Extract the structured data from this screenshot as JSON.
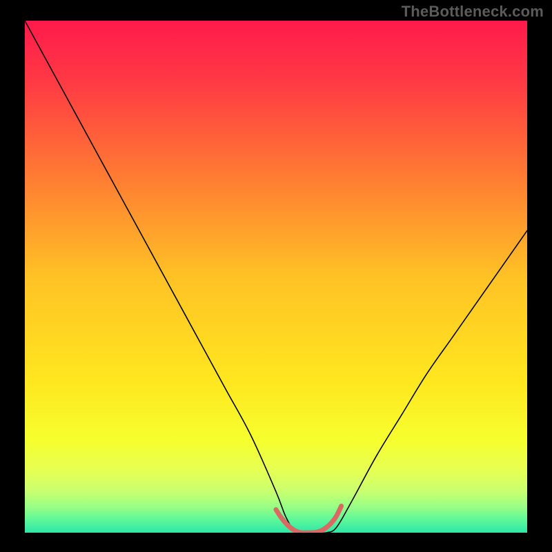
{
  "attribution": "TheBottleneck.com",
  "chart_data": {
    "type": "line",
    "title": "",
    "xlabel": "",
    "ylabel": "",
    "xlim": [
      0,
      100
    ],
    "ylim": [
      0,
      100
    ],
    "grid": false,
    "legend": false,
    "annotations": [],
    "series": [
      {
        "name": "bottleneck-curve",
        "color": "#000000",
        "stroke_width": 1.6,
        "x": [
          0,
          5,
          10,
          15,
          20,
          25,
          30,
          35,
          40,
          45,
          50,
          52,
          54,
          56,
          58,
          60,
          62,
          65,
          70,
          75,
          80,
          85,
          90,
          95,
          100
        ],
        "values": [
          100,
          91,
          82,
          73,
          64,
          55,
          46,
          37,
          28,
          19,
          8,
          3,
          0,
          0,
          0,
          0,
          1,
          6,
          15,
          23,
          31,
          38,
          45,
          52,
          59
        ]
      },
      {
        "name": "sweet-spot-band",
        "color": "#d96a63",
        "stroke_width": 7,
        "x": [
          50,
          51,
          52,
          53,
          54,
          55,
          56,
          57,
          58,
          59,
          60,
          61,
          62,
          63
        ],
        "values": [
          4.5,
          3.0,
          1.8,
          0.9,
          0.3,
          0.0,
          0.0,
          0.0,
          0.1,
          0.4,
          1.0,
          1.9,
          3.2,
          5.2
        ]
      }
    ],
    "background_gradient": {
      "stops": [
        {
          "offset": 0.0,
          "color": "#ff1a4b"
        },
        {
          "offset": 0.12,
          "color": "#ff3a44"
        },
        {
          "offset": 0.3,
          "color": "#ff7a33"
        },
        {
          "offset": 0.5,
          "color": "#ffc225"
        },
        {
          "offset": 0.7,
          "color": "#ffe61f"
        },
        {
          "offset": 0.82,
          "color": "#f6ff2e"
        },
        {
          "offset": 0.88,
          "color": "#e6ff55"
        },
        {
          "offset": 0.92,
          "color": "#c8ff70"
        },
        {
          "offset": 0.95,
          "color": "#97ff86"
        },
        {
          "offset": 0.975,
          "color": "#5cf79a"
        },
        {
          "offset": 1.0,
          "color": "#2de7a8"
        }
      ]
    }
  }
}
